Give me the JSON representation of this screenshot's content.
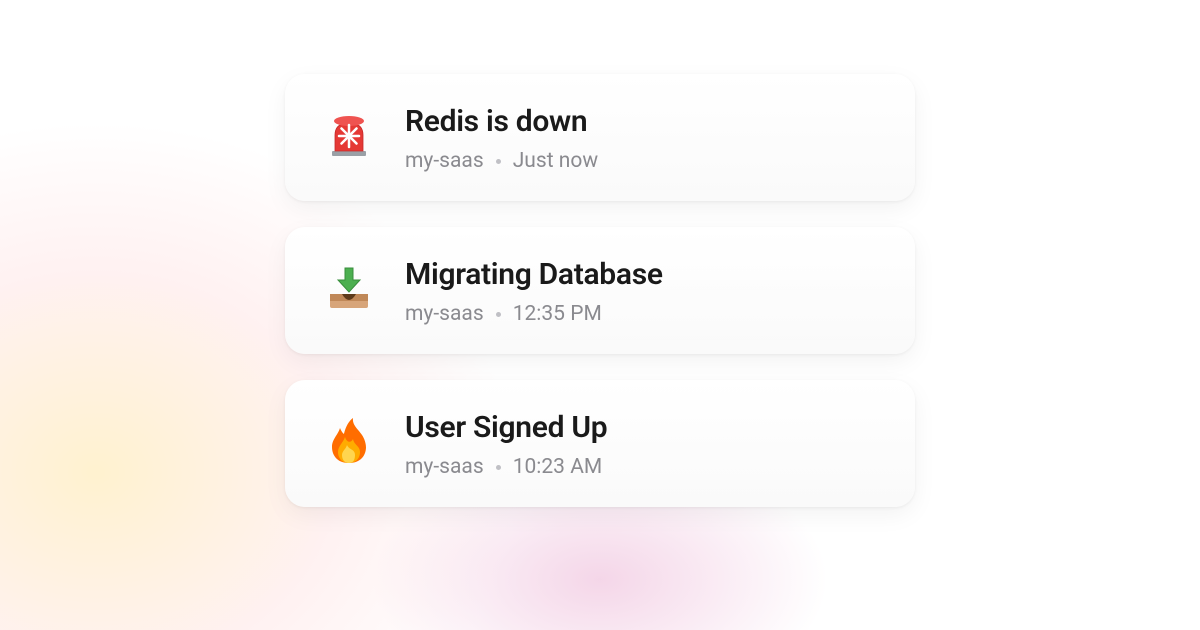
{
  "notifications": [
    {
      "icon": "siren",
      "title": "Redis is down",
      "project": "my-saas",
      "time": "Just now"
    },
    {
      "icon": "download-box",
      "title": "Migrating Database",
      "project": "my-saas",
      "time": "12:35 PM"
    },
    {
      "icon": "fire",
      "title": "User Signed Up",
      "project": "my-saas",
      "time": "10:23 AM"
    }
  ]
}
